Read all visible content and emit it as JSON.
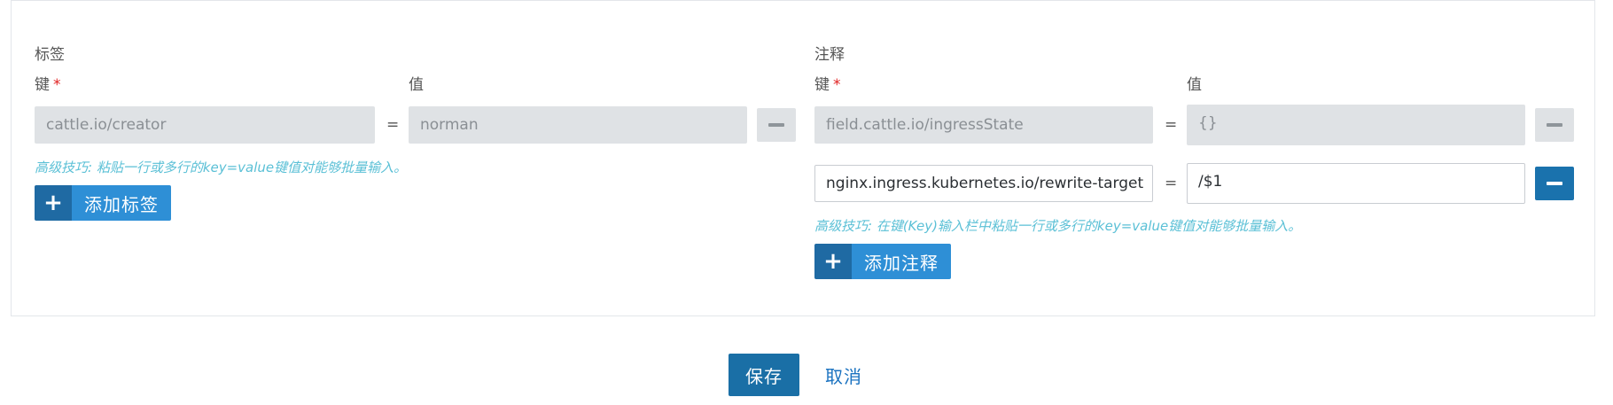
{
  "labels": {
    "title": "标签",
    "key_label": "键",
    "value_label": "值",
    "required_mark": "*",
    "rows": [
      {
        "key": "cattle.io/creator",
        "equals": "=",
        "value": "norman"
      }
    ],
    "hint": "高级技巧: 粘贴一行或多行的key=value键值对能够批量输入。",
    "add_button": {
      "icon": "plus-icon",
      "glyph": "+",
      "label": "添加标签"
    }
  },
  "annotations": {
    "title": "注释",
    "key_label": "键",
    "value_label": "值",
    "required_mark": "*",
    "rows": [
      {
        "key": "field.cattle.io/ingressState",
        "equals": "=",
        "value": "{}"
      },
      {
        "key": "nginx.ingress.kubernetes.io/rewrite-target",
        "equals": "=",
        "value": "/$1"
      }
    ],
    "hint": "高级技巧: 在键(Key)输入栏中粘贴一行或多行的key=value键值对能够批量输入。",
    "add_button": {
      "icon": "plus-icon",
      "glyph": "+",
      "label": "添加注释"
    }
  },
  "footer": {
    "save_label": "保存",
    "cancel_label": "取消"
  },
  "colors": {
    "primary": "#1a6fa6",
    "button_light": "#2e8fd6",
    "hint": "#5bc0d6",
    "disabled_bg": "#dfe2e5",
    "required": "#e02020"
  }
}
